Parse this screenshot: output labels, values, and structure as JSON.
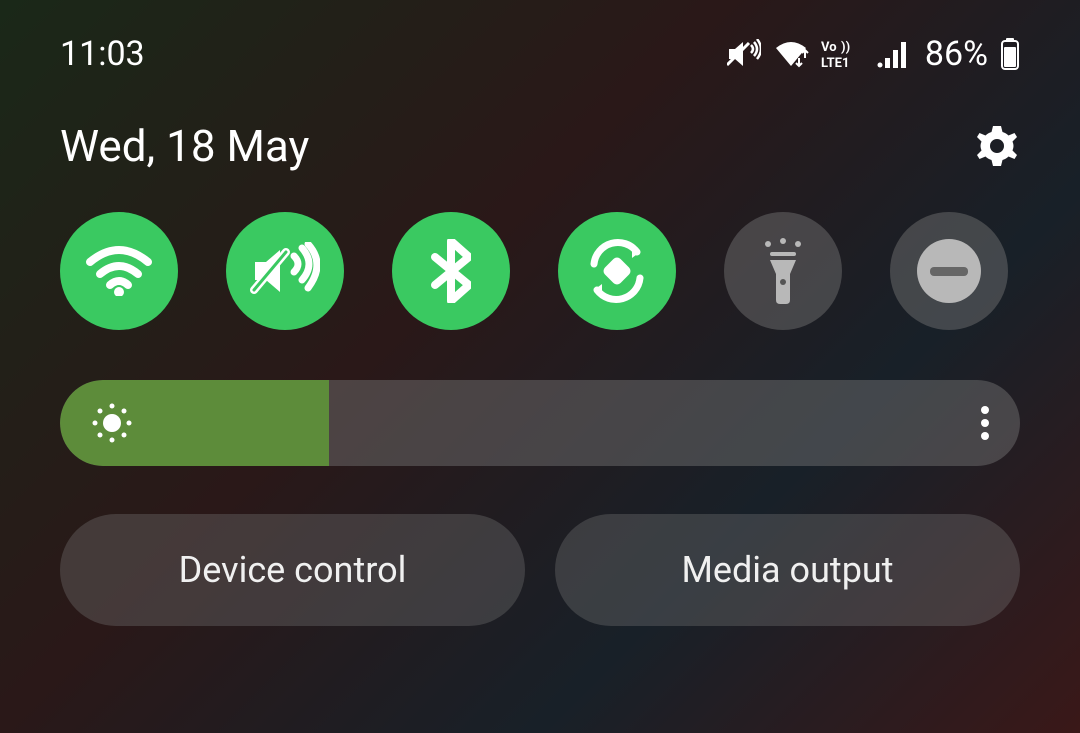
{
  "status_bar": {
    "time": "11:03",
    "battery_text": "86%"
  },
  "date": "Wed, 18 May",
  "quick_toggles": [
    {
      "name": "wifi",
      "active": true
    },
    {
      "name": "mute-vibrate",
      "active": true
    },
    {
      "name": "bluetooth",
      "active": true
    },
    {
      "name": "auto-rotate",
      "active": true
    },
    {
      "name": "flashlight",
      "active": false
    },
    {
      "name": "dnd",
      "active": false
    }
  ],
  "brightness": {
    "percent": 28
  },
  "actions": {
    "device_control": "Device control",
    "media_output": "Media output"
  },
  "colors": {
    "active_toggle": "#3ac961",
    "inactive_toggle": "rgba(120,120,120,0.45)",
    "brightness_fill": "#5d8c3a"
  }
}
